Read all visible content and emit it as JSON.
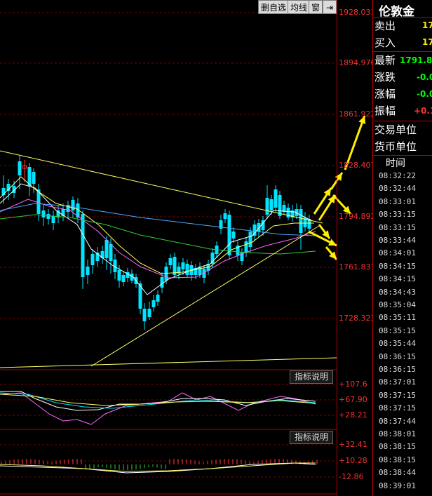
{
  "toolbar": {
    "delete_watch": "删自选",
    "avg_line": "均线",
    "window": "窗",
    "collapse_icon": "collapse-right-icon"
  },
  "price_axis": {
    "labels": [
      "1928.031",
      "1894.976",
      "1861.922",
      "1828.407",
      "1794.892",
      "1761.837",
      "1728.323"
    ]
  },
  "indicator1": {
    "button": "指标说明",
    "labels": [
      "+107.6",
      "+67.90",
      "+28.21"
    ]
  },
  "indicator2": {
    "button": "指标说明",
    "labels": [
      "+32.41",
      "+10.28",
      "-12.86"
    ]
  },
  "side_panel": {
    "title": "伦敦金",
    "rows": [
      {
        "label": "卖出",
        "value": "17",
        "color": "#ffee00"
      },
      {
        "label": "买入",
        "value": "17",
        "color": "#ffee00"
      },
      {
        "label": "最新",
        "value": "1791.8",
        "color": "#00ff00"
      },
      {
        "label": "涨跌",
        "value": "-0.0",
        "color": "#00ff00"
      },
      {
        "label": "涨幅",
        "value": "-0.0",
        "color": "#00ff00"
      },
      {
        "label": "振幅",
        "value": "+0.1",
        "color": "#ff3333"
      }
    ],
    "trade_unit": "交易单位",
    "currency_unit": "货币单位",
    "time_header": "时间",
    "times": [
      "08:32:22",
      "08:32:44",
      "08:33:01",
      "08:33:15",
      "08:33:15",
      "08:33:44",
      "08:34:01",
      "08:34:15",
      "08:34:15",
      "08:34:43",
      "08:35:04",
      "08:35:11",
      "08:35:15",
      "08:35:44",
      "08:36:15",
      "08:36:15",
      "08:37:01",
      "08:37:15",
      "08:37:15",
      "08:37:44",
      "08:38:01",
      "08:38:15",
      "08:38:15",
      "08:38:44",
      "08:39:01"
    ]
  },
  "colors": {
    "up": "#ff3333",
    "down": "#00e5ff",
    "ma_white": "#ffffff",
    "ma_yellow": "#ffff66",
    "ma_magenta": "#ff66ff",
    "ma_green": "#33cc33",
    "ma_blue": "#4aa8ff",
    "arrow": "#ffee00"
  }
}
